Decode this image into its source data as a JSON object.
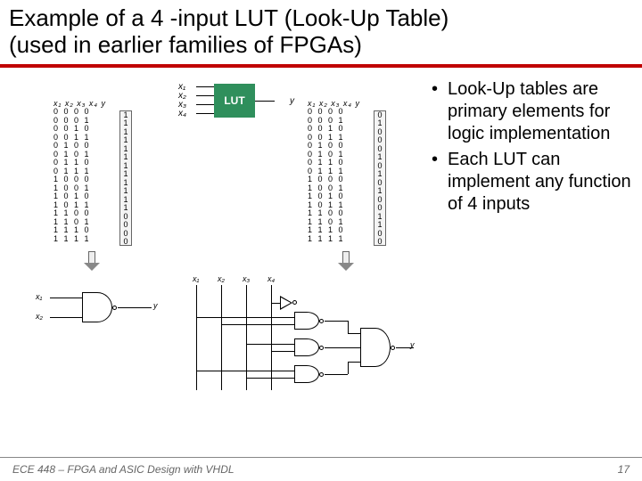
{
  "title_line1": "Example of a 4 -input LUT (Look-Up Table)",
  "title_line2": "(used in earlier families of FPGAs)",
  "bullets": [
    "Look-Up tables are primary elements for logic implementation",
    "Each LUT can implement any function of 4 inputs"
  ],
  "lut": {
    "label": "LUT",
    "inputs": [
      "x₁",
      "x₂",
      "x₃",
      "x₄"
    ],
    "output": "y"
  },
  "truth_header": "x₁ x₂ x₃ x₄   y",
  "truth_inputs": [
    "0 0 0 0",
    "0 0 0 1",
    "0 0 1 0",
    "0 0 1 1",
    "0 1 0 0",
    "0 1 0 1",
    "0 1 1 0",
    "0 1 1 1",
    "1 0 0 0",
    "1 0 0 1",
    "1 0 1 0",
    "1 0 1 1",
    "1 1 0 0",
    "1 1 0 1",
    "1 1 1 0",
    "1 1 1 1"
  ],
  "y_left": [
    "1",
    "1",
    "1",
    "1",
    "1",
    "1",
    "1",
    "1",
    "1",
    "1",
    "1",
    "1",
    "0",
    "0",
    "0",
    "0"
  ],
  "y_right": [
    "0",
    "1",
    "0",
    "0",
    "0",
    "1",
    "0",
    "1",
    "0",
    "1",
    "0",
    "0",
    "1",
    "1",
    "0",
    "0"
  ],
  "gate_left": {
    "inputs": [
      "x₁",
      "x₂"
    ],
    "output": "y"
  },
  "gate_right": {
    "inputs": [
      "x₁",
      "x₂",
      "x₃",
      "x₄"
    ],
    "output": "y"
  },
  "footer_left": "ECE 448 – FPGA and ASIC Design with VHDL",
  "footer_right": "17"
}
